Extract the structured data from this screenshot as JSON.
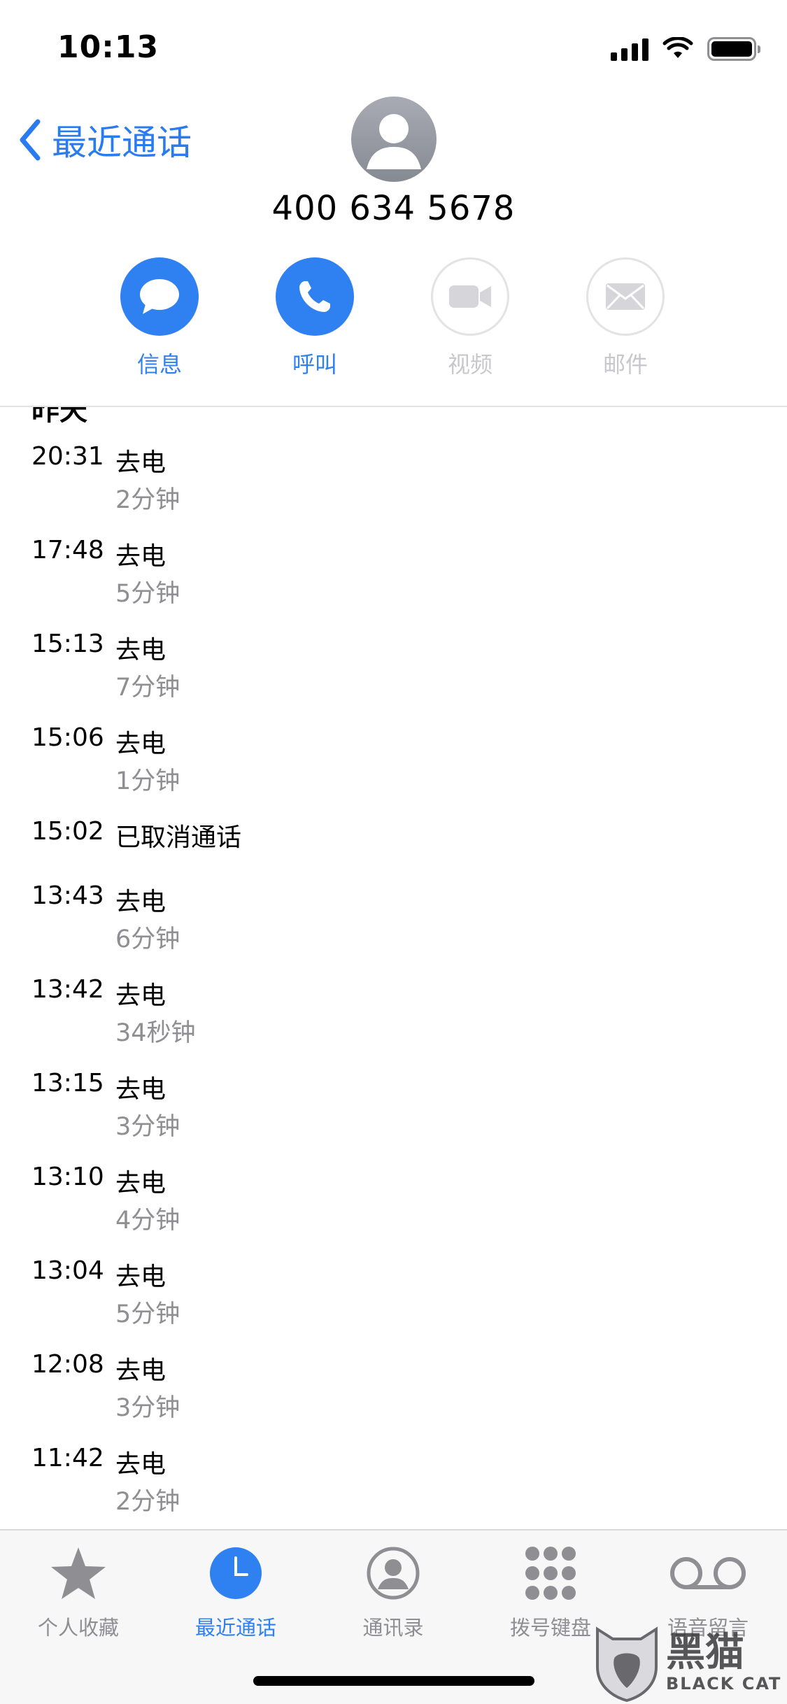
{
  "status_bar": {
    "time": "10:13"
  },
  "header": {
    "back_label": "最近通话",
    "phone_number": "400 634 5678"
  },
  "actions": [
    {
      "label": "信息",
      "icon": "message-icon",
      "enabled": true
    },
    {
      "label": "呼叫",
      "icon": "phone-icon",
      "enabled": true
    },
    {
      "label": "视频",
      "icon": "video-icon",
      "enabled": false
    },
    {
      "label": "邮件",
      "icon": "mail-icon",
      "enabled": false
    }
  ],
  "calls": {
    "section_label": "昨天",
    "items": [
      {
        "time": "20:31",
        "type": "去电",
        "duration": "2分钟"
      },
      {
        "time": "17:48",
        "type": "去电",
        "duration": "5分钟"
      },
      {
        "time": "15:13",
        "type": "去电",
        "duration": "7分钟"
      },
      {
        "time": "15:06",
        "type": "去电",
        "duration": "1分钟"
      },
      {
        "time": "15:02",
        "type": "已取消通话",
        "duration": ""
      },
      {
        "time": "13:43",
        "type": "去电",
        "duration": "6分钟"
      },
      {
        "time": "13:42",
        "type": "去电",
        "duration": "34秒钟"
      },
      {
        "time": "13:15",
        "type": "去电",
        "duration": "3分钟"
      },
      {
        "time": "13:10",
        "type": "去电",
        "duration": "4分钟"
      },
      {
        "time": "13:04",
        "type": "去电",
        "duration": "5分钟"
      },
      {
        "time": "12:08",
        "type": "去电",
        "duration": "3分钟"
      },
      {
        "time": "11:42",
        "type": "去电",
        "duration": "2分钟"
      }
    ]
  },
  "tab_bar": {
    "items": [
      {
        "label": "个人收藏",
        "icon": "star-icon",
        "active": false
      },
      {
        "label": "最近通话",
        "icon": "clock-icon",
        "active": true
      },
      {
        "label": "通讯录",
        "icon": "contacts-icon",
        "active": false
      },
      {
        "label": "拨号键盘",
        "icon": "keypad-icon",
        "active": false
      },
      {
        "label": "语音留言",
        "icon": "voicemail-icon",
        "active": false
      }
    ]
  },
  "watermark": {
    "text_cn": "黑猫",
    "text_en": "BLACK CAT"
  },
  "colors": {
    "accent": "#2f80f1",
    "secondary_text": "#8e8e93",
    "disabled": "#c8c8cc"
  }
}
